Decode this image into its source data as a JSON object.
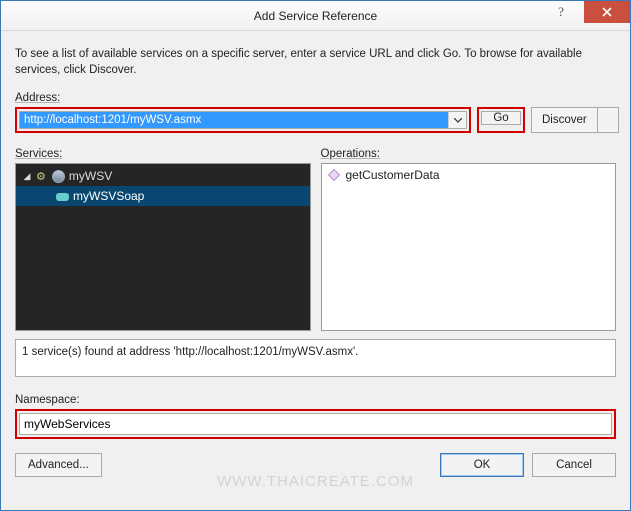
{
  "window": {
    "title": "Add Service Reference"
  },
  "intro": "To see a list of available services on a specific server, enter a service URL and click Go. To browse for available services, click Discover.",
  "labels": {
    "address": "Address:",
    "services": "Services:",
    "operations": "Operations:",
    "namespace": "Namespace:"
  },
  "address": {
    "value": "http://localhost:1201/myWSV.asmx"
  },
  "buttons": {
    "go": "Go",
    "discover": "Discover",
    "advanced": "Advanced...",
    "ok": "OK",
    "cancel": "Cancel"
  },
  "services_tree": {
    "root": {
      "label": "myWSV"
    },
    "child": {
      "label": "myWSVSoap"
    }
  },
  "operations": [
    "getCustomerData"
  ],
  "status": "1 service(s) found at address 'http://localhost:1201/myWSV.asmx'.",
  "namespace": {
    "value": "myWebServices"
  },
  "watermark": "WWW.THAICREATE.COM"
}
